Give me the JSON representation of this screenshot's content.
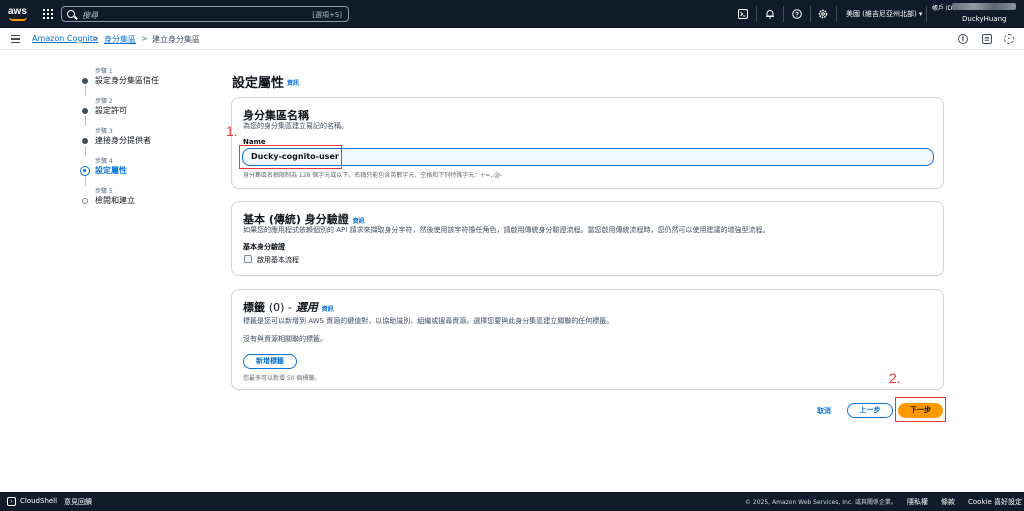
{
  "topnav": {
    "logo": "aws",
    "search_placeholder": "搜尋",
    "search_shortcut": "[選項+S]",
    "region": "美國 (維吉尼亞州北部)",
    "account_label": "帳戶 ID:",
    "username": "DuckyHuang"
  },
  "breadcrumb": {
    "service": "Amazon Cognito",
    "section": "身分集區",
    "current": "建立身分集區",
    "separator": ">"
  },
  "steps": [
    {
      "num": "步驟 1",
      "label": "設定身分集區信任",
      "state": "done"
    },
    {
      "num": "步驟 2",
      "label": "設定許可",
      "state": "done"
    },
    {
      "num": "步驟 3",
      "label": "連接身分提供者",
      "state": "done"
    },
    {
      "num": "步驟 4",
      "label": "設定屬性",
      "state": "active"
    },
    {
      "num": "步驟 5",
      "label": "檢閱和建立",
      "state": "pending"
    }
  ],
  "main": {
    "title": "設定屬性",
    "info": "資訊"
  },
  "pool_name_card": {
    "title": "身分集區名稱",
    "description": "為您的身分集區建立易記的名稱。",
    "field_label": "Name",
    "value": "Ducky-cognito-user",
    "constraint": "身分集區名稱限制為 128 個字元或以下。名稱只能包含英數字元、空格和下列特殊字元：+=,.@-"
  },
  "basic_auth_card": {
    "title": "基本 (傳統) 身分驗證",
    "info": "資訊",
    "description": "如果您的應用程式依賴個別的 API 請求來擷取身分字符，然後使用該字符擔任角色，請啟用傳統身分驗證流程。當您啟用傳統流程時，您仍然可以使用建議的增強型流程。",
    "field_label": "基本身分驗證",
    "checkbox_label": "啟用基本流程",
    "checked": false
  },
  "tags_card": {
    "title_prefix": "標籤",
    "title_count": "(0) -",
    "title_optional": "選用",
    "info": "資訊",
    "description": "標籤是您可以新增到 AWS 資源的鍵值對，以協助識別、組織或搜尋資源。選擇您要與此身分集區建立關聯的任何標籤。",
    "empty_text": "沒有與資源相關聯的標籤。",
    "add_button": "新增標籤",
    "limit_note": "您最多可以新增 50 個標籤。"
  },
  "actions": {
    "cancel": "取消",
    "previous": "上一步",
    "next": "下一步"
  },
  "annotations": {
    "one": "1.",
    "two": "2."
  },
  "footer": {
    "cloudshell": "CloudShell",
    "feedback": "意見回饋",
    "copyright": "© 2025, Amazon Web Services, Inc. 或其關係企業。",
    "privacy": "隱私權",
    "terms": "條款",
    "cookies": "Cookie 喜好設定"
  },
  "colors": {
    "nav_bg": "#0f1b2a",
    "link": "#0972d3",
    "primary_button": "#ff9900",
    "annotation": "#e53935"
  }
}
